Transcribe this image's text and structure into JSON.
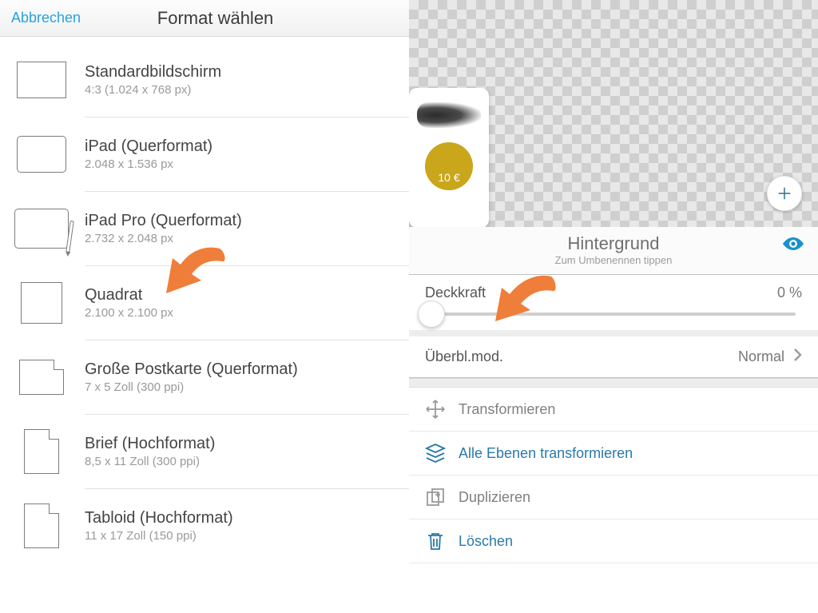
{
  "left": {
    "cancel": "Abbrechen",
    "title": "Format wählen",
    "formats": [
      {
        "name": "Standardbildschirm",
        "sub": "4:3 (1.024 x 768 px)"
      },
      {
        "name": "iPad (Querformat)",
        "sub": "2.048 x 1.536 px"
      },
      {
        "name": "iPad Pro (Querformat)",
        "sub": "2.732 x 2.048 px"
      },
      {
        "name": "Quadrat",
        "sub": "2.100 x 2.100 px"
      },
      {
        "name": "Große Postkarte (Querformat)",
        "sub": "7 x 5 Zoll  (300 ppi)"
      },
      {
        "name": "Brief (Hochformat)",
        "sub": "8,5 x 11 Zoll  (300 ppi)"
      },
      {
        "name": "Tabloid (Hochformat)",
        "sub": "11 x 17 Zoll  (150 ppi)"
      }
    ]
  },
  "right": {
    "coin_label": "10 €",
    "layer_title": "Hintergrund",
    "layer_hint": "Zum Umbenennen tippen",
    "opacity_label": "Deckkraft",
    "opacity_value": "0 %",
    "blend_label": "Überbl.mod.",
    "blend_value": "Normal",
    "tools": {
      "transform": "Transformieren",
      "transform_all": "Alle Ebenen transformieren",
      "duplicate": "Duplizieren",
      "delete": "Löschen"
    }
  }
}
